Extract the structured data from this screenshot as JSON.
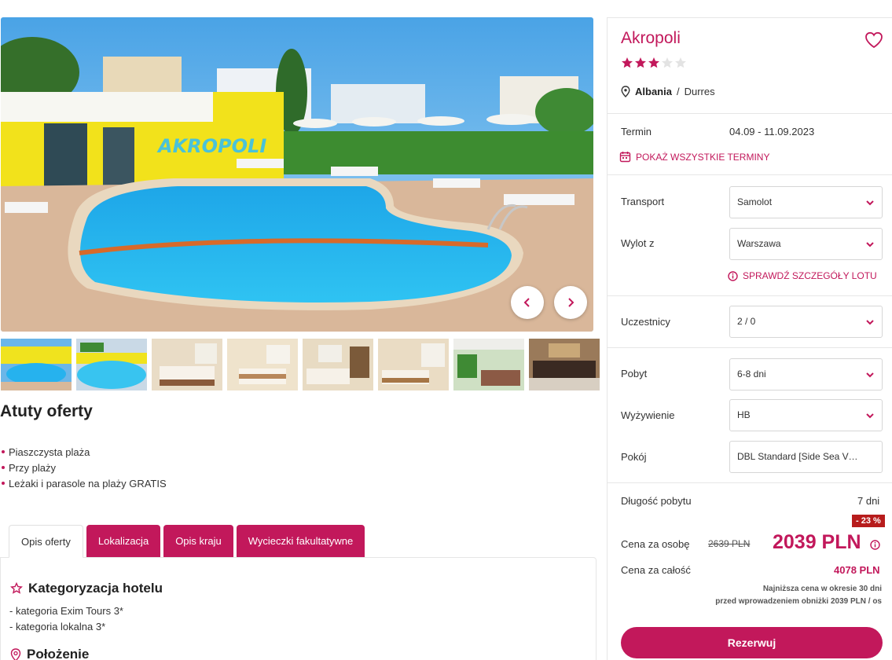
{
  "gallery": {
    "hero_sign": "AKROPOLI",
    "prev_icon": "chevron-left-icon",
    "next_icon": "chevron-right-icon",
    "thumbnails": [
      "pool",
      "pool-aerial",
      "room-twin",
      "room-double",
      "room-bright",
      "room-standard",
      "restaurant-terrace",
      "reception"
    ]
  },
  "advantages": {
    "title": "Atuty oferty",
    "items": [
      "Piaszczysta plaża",
      "Przy plaży",
      "Leżaki i parasole na plaży GRATIS"
    ]
  },
  "tabs": [
    {
      "label": "Opis oferty",
      "active": true
    },
    {
      "label": "Lokalizacja",
      "active": false
    },
    {
      "label": "Opis kraju",
      "active": false
    },
    {
      "label": "Wycieczki fakultatywne",
      "active": false
    }
  ],
  "description": {
    "categorization": {
      "title": "Kategoryzacja hotelu",
      "icon": "star-outline-icon",
      "lines": [
        "- kategoria Exim Tours 3*",
        "- kategoria lokalna 3*"
      ]
    },
    "location": {
      "title": "Położenie",
      "icon": "map-pin-icon"
    }
  },
  "booking": {
    "hotel_name": "Akropoli",
    "rating": 3,
    "max_rating": 5,
    "country": "Albania",
    "separator": "/",
    "city": "Durres",
    "term_label": "Termin",
    "term_value": "04.09 - 11.09.2023",
    "show_all_terms": "POKAŻ WSZYSTKIE TERMINY",
    "transport_label": "Transport",
    "transport_value": "Samolot",
    "departure_label": "Wylot z",
    "departure_value": "Warszawa",
    "flight_details": "SPRAWDŹ SZCZEGÓŁY LOTU",
    "participants_label": "Uczestnicy",
    "participants_value": "2 / 0",
    "stay_label": "Pobyt",
    "stay_value": "6-8 dni",
    "board_label": "Wyżywienie",
    "board_value": "HB",
    "room_label": "Pokój",
    "room_value": "DBL Standard [Side Sea View]/Sea View",
    "length_label": "Długość pobytu",
    "length_value": "7 dni",
    "discount": "- 23 %",
    "per_person_label": "Cena za osobę",
    "old_price": "2639 PLN",
    "new_price": "2039 PLN",
    "total_label": "Cena za całość",
    "total_value": "4078 PLN",
    "note_line1": "Najniższa cena w okresie 30 dni",
    "note_line2": "przed wprowadzeniem obniżki 2039 PLN / os",
    "book_button": "Rezerwuj"
  },
  "colors": {
    "accent": "#c2185b",
    "discount": "#b71c1c",
    "star_empty": "#e3e3e3"
  }
}
